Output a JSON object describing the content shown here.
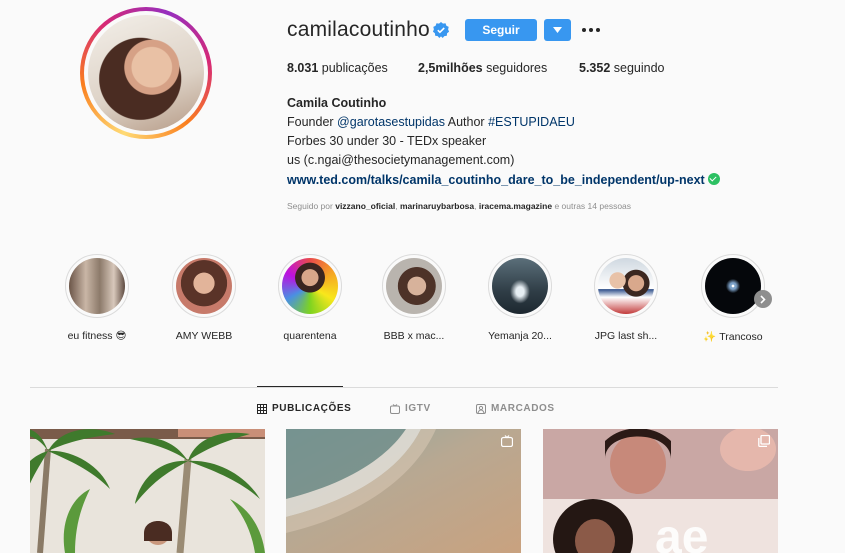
{
  "profile": {
    "username": "camilacoutinho",
    "follow_label": "Seguir",
    "stats": {
      "posts_value": "8.031",
      "posts_label": "publicações",
      "followers_value": "2,5milhões",
      "followers_label": "seguidores",
      "following_value": "5.352",
      "following_label": "seguindo"
    },
    "bio": {
      "name": "Camila Coutinho",
      "line1_prefix": "Founder",
      "line1_mention": "@garotasestupidas",
      "line1_mid": "Author",
      "line1_hashtag": "#ESTUPIDAEU",
      "line2": "Forbes 30 under 30 - TEDx speaker",
      "line3": "us (c.ngai@thesocietymanagement.com)",
      "link": "www.ted.com/talks/camila_coutinho_dare_to_be_independent/up-next"
    },
    "followed_by": {
      "prefix": "Seguido por",
      "user1": "vizzano_oficial",
      "user2": "marinaruybarbosa",
      "user3": "iracema.magazine",
      "suffix": "e outras 14 pessoas"
    }
  },
  "highlights": [
    {
      "label": "eu fitness 😎"
    },
    {
      "label": "AMY WEBB"
    },
    {
      "label": "quarentena"
    },
    {
      "label": "BBB x mac..."
    },
    {
      "label": "Yemanja 20..."
    },
    {
      "label": "JPG last sh..."
    },
    {
      "label": "✨ Trancoso"
    }
  ],
  "tabs": [
    {
      "label": "PUBLICAÇÕES",
      "active": true,
      "icon": "grid-icon"
    },
    {
      "label": "IGTV",
      "active": false,
      "icon": "igtv-icon"
    },
    {
      "label": "MARCADOS",
      "active": false,
      "icon": "tagged-icon"
    }
  ],
  "colors": {
    "accent": "#3897f0",
    "link": "#003569",
    "muted": "#8e8e8e",
    "verified": "#3897f0",
    "border": "#dbdbdb"
  }
}
